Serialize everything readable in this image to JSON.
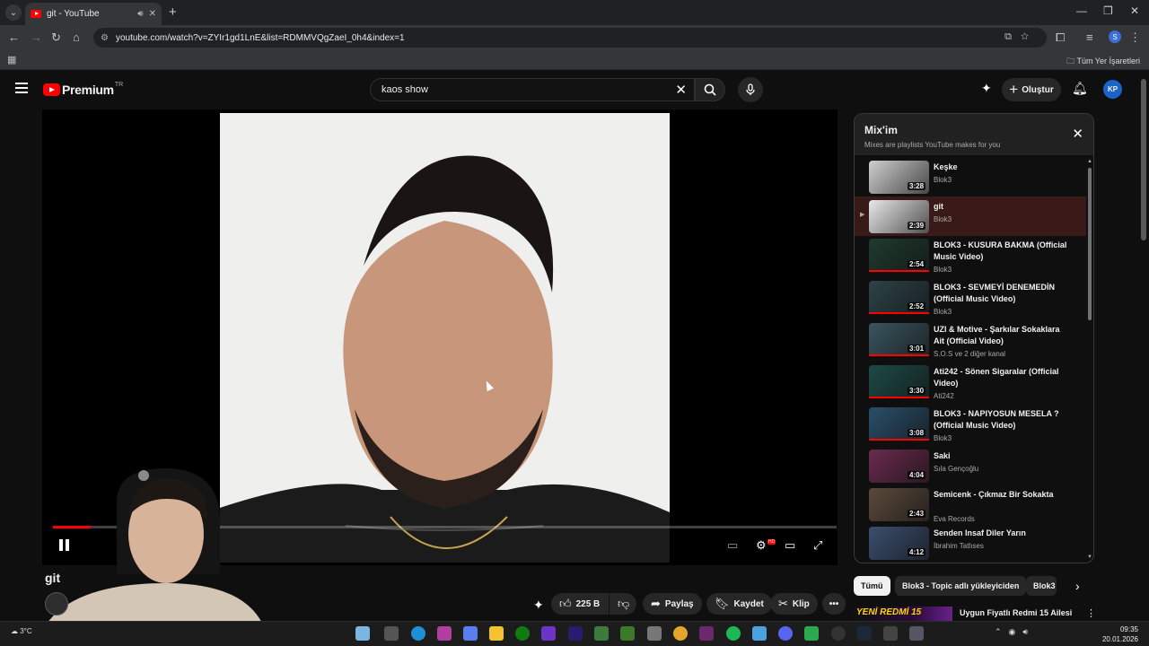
{
  "browser": {
    "tab_title": "git - YouTube",
    "url": "youtube.com/watch?v=ZYIr1gd1LnE&list=RDMMVQgZaeI_0h4&index=1",
    "bookmarks_all": "Tüm Yer İşaretleri",
    "profile_initial": "S"
  },
  "header": {
    "logo_text": "Premium",
    "country_code": "TR",
    "search_value": "kaos show",
    "create_label": "Oluştur",
    "avatar_initials": "KP"
  },
  "player": {
    "progress_fraction": 0.048,
    "hd_badge": "HD"
  },
  "video": {
    "title": "git",
    "like_count": "225 B",
    "share_label": "Paylaş",
    "save_label": "Kaydet",
    "clip_label": "Klip"
  },
  "playlist": {
    "title": "Mix'im",
    "subtitle": "Mixes are playlists YouTube makes for you",
    "items": [
      {
        "title": "Keşke",
        "channel": "Blok3",
        "duration": "3:28",
        "active": false,
        "color": "#cfcfcf"
      },
      {
        "title": "git",
        "channel": "Blok3",
        "duration": "2:39",
        "active": true,
        "color": "#e9e9e9"
      },
      {
        "title": "BLOK3 - KUSURA BAKMA (Official Music Video)",
        "channel": "Blok3",
        "duration": "2:54",
        "active": false,
        "color": "#1f3a2f"
      },
      {
        "title": "BLOK3 - SEVMEYİ DENEMEDİN (Official Music Video)",
        "channel": "Blok3",
        "duration": "2:52",
        "active": false,
        "color": "#2c4348"
      },
      {
        "title": "UZI & Motive - Şarkılar Sokaklara Ait (Official Video)",
        "channel": "S.O.S ve 2 diğer kanal",
        "duration": "3:01",
        "active": false,
        "color": "#3a5560"
      },
      {
        "title": "Ati242 - Sönen Sigaralar (Official Video)",
        "channel": "Ati242",
        "duration": "3:30",
        "active": false,
        "color": "#1d4a46"
      },
      {
        "title": "BLOK3 - NAPIYOSUN MESELA ? (Official Music Video)",
        "channel": "Blok3",
        "duration": "3:08",
        "active": false,
        "color": "#2a4f6a"
      },
      {
        "title": "Saki",
        "channel": "Sıla Gençoğlu",
        "duration": "4:04",
        "active": false,
        "color": "#6a2a4e"
      },
      {
        "title": "Semicenk - Çıkmaz Bir Sokakta",
        "channel": "Eva Records",
        "duration": "2:43",
        "active": false,
        "color": "#5b4a3c"
      },
      {
        "title": "Senden Insaf Diler Yarın",
        "channel": "İbrahim Tatlıses",
        "duration": "4:12",
        "active": false,
        "color": "#3b4f6e"
      }
    ]
  },
  "chips": [
    "Tümü",
    "Blok3 - Topic adlı yükleyiciden",
    "Blok3"
  ],
  "recommendation": {
    "thumb_text": "YENİ REDMİ 15",
    "title": "Uygun Fiyatlı Redmi 15 Ailesi"
  },
  "taskbar": {
    "temperature": "3°C",
    "time": "09:35",
    "date": "20.01.2026"
  }
}
